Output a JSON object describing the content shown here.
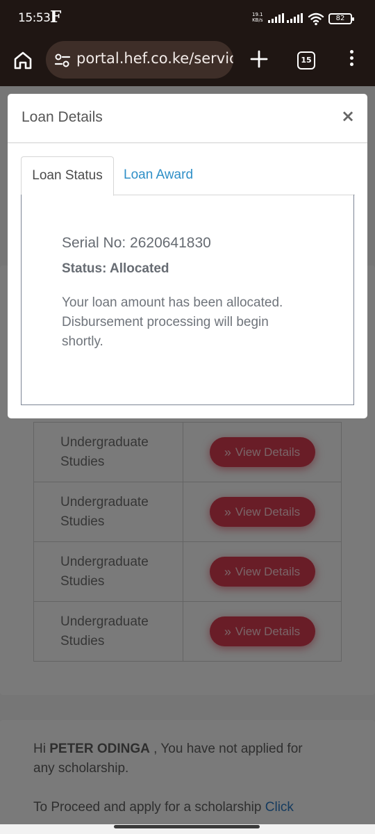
{
  "status_bar": {
    "time": "15:53",
    "app_letter": "F",
    "net_speed_top": "19.1",
    "net_speed_bottom": "KB/s",
    "battery": "82"
  },
  "browser": {
    "url": "portal.hef.co.ke/servic",
    "tab_count": "15"
  },
  "loan_table": {
    "rows": [
      {
        "level": "Undergraduate Studies",
        "button": "View Details"
      },
      {
        "level": "Undergraduate Studies",
        "button": "View Details"
      },
      {
        "level": "Undergraduate Studies",
        "button": "View Details"
      },
      {
        "level": "Undergraduate Studies",
        "button": "View Details"
      }
    ]
  },
  "scholarship": {
    "greeting_prefix": "Hi ",
    "name": "PETER ODINGA",
    "greeting_suffix": " , You have not applied for any scholarship.",
    "proceed_text": "To Proceed and apply for a scholarship ",
    "link_text": "Click"
  },
  "modal": {
    "title": "Loan Details",
    "close": "×",
    "tabs": [
      "Loan Status",
      "Loan Award"
    ],
    "serial": "Serial No: 2620641830",
    "status": "Status: Allocated",
    "message": "Your loan amount has been allocated. Disbursement processing will begin shortly."
  }
}
